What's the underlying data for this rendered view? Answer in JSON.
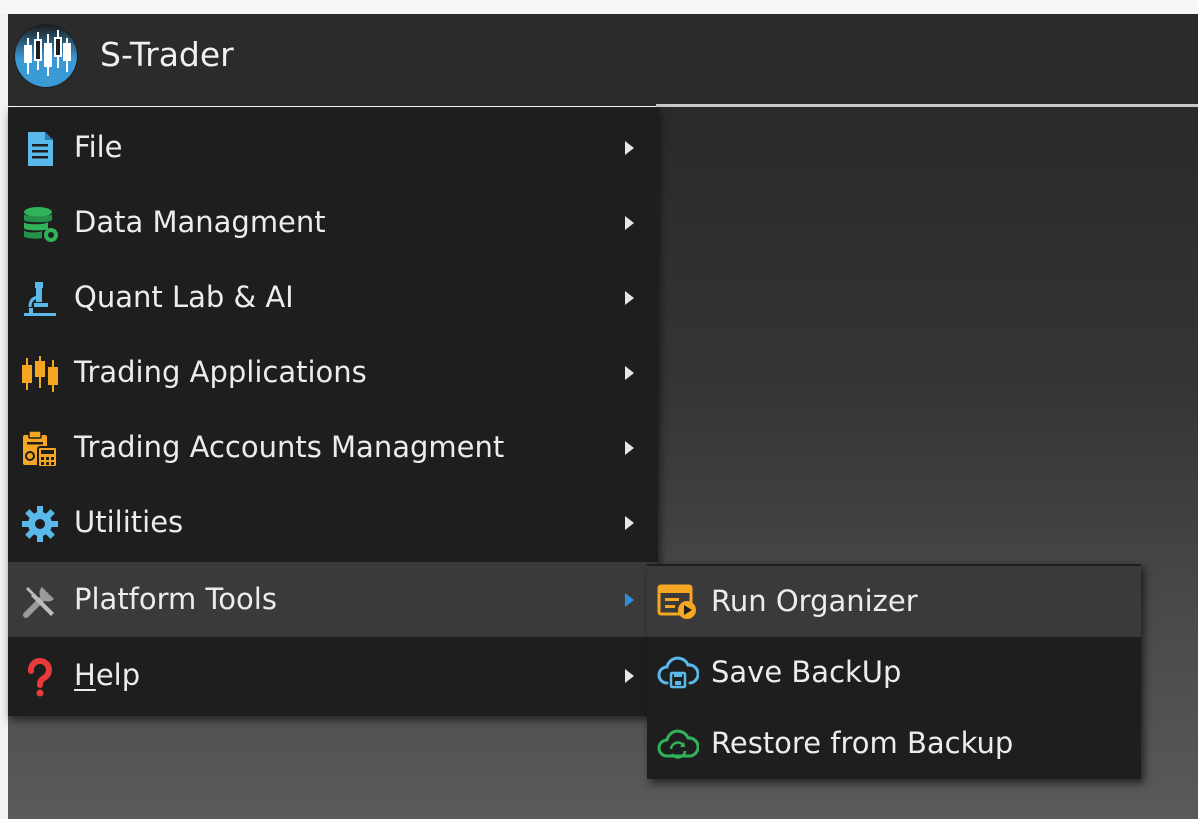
{
  "app": {
    "title": "S-Trader",
    "logo_icon": "candlestick-logo-icon"
  },
  "colors": {
    "titlebar": "#2b2b2b",
    "menu_bg": "#1e1e1e",
    "menu_hover": "#3a3a3a",
    "text": "#ececec",
    "accent_arrow": "#2f8fde"
  },
  "main_menu": {
    "items": [
      {
        "label": "File",
        "icon": "document-icon"
      },
      {
        "label": "Data Managment",
        "icon": "database-gear-icon"
      },
      {
        "label": "Quant Lab & AI",
        "icon": "microscope-icon"
      },
      {
        "label": "Trading Applications",
        "icon": "candlestick-icon"
      },
      {
        "label": "Trading Accounts Managment",
        "icon": "clipboard-calculator-icon"
      },
      {
        "label": "Utilities",
        "icon": "gear-icon"
      },
      {
        "label": "Platform Tools",
        "icon": "tools-icon"
      },
      {
        "label_first": "H",
        "label_rest": "elp",
        "label": "Help",
        "icon": "question-icon"
      }
    ]
  },
  "platform_tools_submenu": {
    "items": [
      {
        "label": "Run Organizer",
        "icon": "organizer-run-icon"
      },
      {
        "label": "Save BackUp",
        "icon": "cloud-save-icon"
      },
      {
        "label": "Restore from Backup",
        "icon": "cloud-restore-icon"
      }
    ]
  }
}
